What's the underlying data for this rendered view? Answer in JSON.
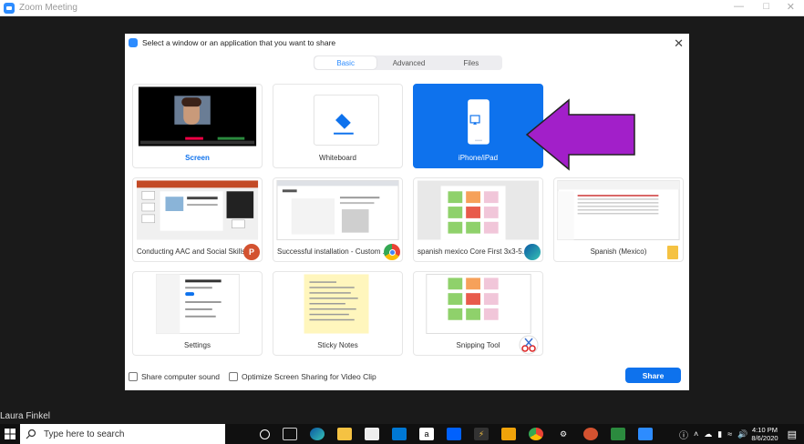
{
  "window": {
    "title": "Zoom Meeting"
  },
  "dialog": {
    "title": "Select a window or an application that you want to share",
    "tabs": [
      {
        "label": "Basic",
        "active": true
      },
      {
        "label": "Advanced",
        "active": false
      },
      {
        "label": "Files",
        "active": false
      }
    ],
    "tiles": [
      {
        "label": "Screen"
      },
      {
        "label": "Whiteboard"
      },
      {
        "label": "iPhone/iPad"
      },
      {
        "label": "Conducting AAC and Social Skills...",
        "app": "P"
      },
      {
        "label": "Successful installation - Custom ..."
      },
      {
        "label": "spanish mexico Core First 3x3-5..."
      },
      {
        "label": "Spanish (Mexico)"
      },
      {
        "label": "Settings"
      },
      {
        "label": "Sticky Notes"
      },
      {
        "label": "Snipping Tool"
      }
    ],
    "footer": {
      "share_sound": "Share computer sound",
      "optimize_video": "Optimize Screen Sharing for Video Clip",
      "share_button": "Share"
    }
  },
  "participant": {
    "name": "Laura Finkel"
  },
  "taskbar": {
    "search_placeholder": "Type here to search",
    "time": "4:10 PM",
    "date": "8/6/2020"
  },
  "colors": {
    "accent": "#0e72ed",
    "arrow": "#a21fc9"
  }
}
